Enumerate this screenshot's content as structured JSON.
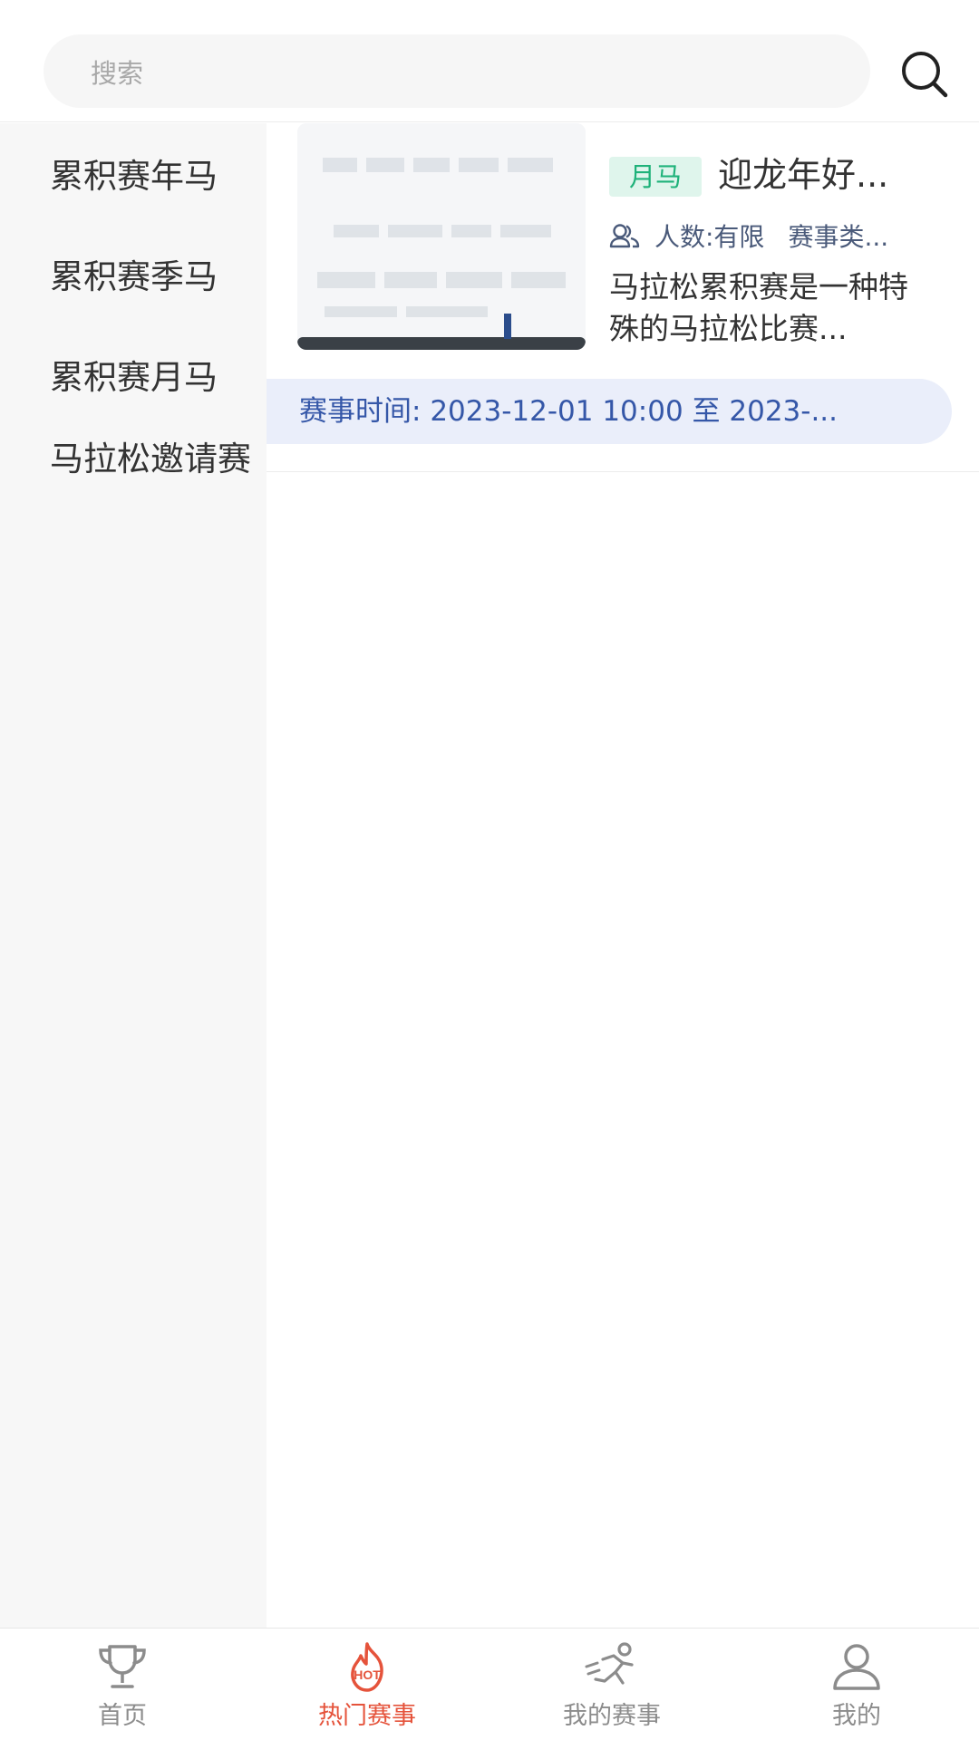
{
  "search": {
    "placeholder": "搜索"
  },
  "sidebar": {
    "items": [
      {
        "label": "累积赛年马"
      },
      {
        "label": "累积赛季马"
      },
      {
        "label": "累积赛月马"
      },
      {
        "label": "马拉松邀请赛"
      }
    ]
  },
  "events": [
    {
      "tag": "月马",
      "title": "迎龙年好...",
      "people": "人数:有限",
      "type": "赛事类...",
      "description": "马拉松累积赛是一种特殊的马拉松比赛...",
      "time_label": "赛事时间:",
      "time_range": "2023-12-01 10:00 至 2023-..."
    }
  ],
  "tabbar": {
    "items": [
      {
        "label": "首页",
        "icon": "trophy-icon"
      },
      {
        "label": "热门赛事",
        "icon": "hot-icon",
        "active": true
      },
      {
        "label": "我的赛事",
        "icon": "runner-icon"
      },
      {
        "label": "我的",
        "icon": "profile-icon"
      }
    ]
  },
  "colors": {
    "active": "#e5533b",
    "tag_bg": "#dff5ec",
    "tag_text": "#1fb27a",
    "time_bar_bg": "#eaeefa",
    "time_bar_text": "#3557a8"
  }
}
